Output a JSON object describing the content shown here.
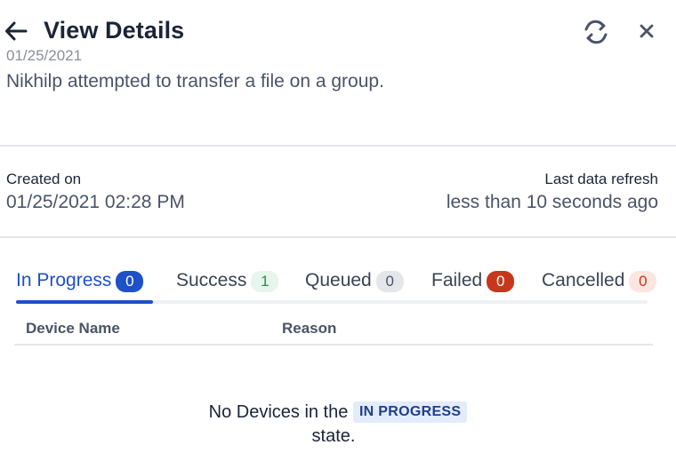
{
  "header": {
    "title": "View Details"
  },
  "event": {
    "date": "01/25/2021",
    "description": "Nikhilp attempted to transfer a file on a group."
  },
  "meta": {
    "created_label": "Created on",
    "created_value": "01/25/2021 02:28 PM",
    "refresh_label": "Last data refresh",
    "refresh_value": "less than 10 seconds ago"
  },
  "tabs": [
    {
      "label": "In Progress",
      "count": "0",
      "active": true,
      "badge_color": "#1e50c8"
    },
    {
      "label": "Success",
      "count": "1",
      "active": false,
      "badge_color": "#e6f6ec"
    },
    {
      "label": "Queued",
      "count": "0",
      "active": false,
      "badge_color": "#e4e6ea"
    },
    {
      "label": "Failed",
      "count": "0",
      "active": false,
      "badge_color": "#c7371b"
    },
    {
      "label": "Cancelled",
      "count": "0",
      "active": false,
      "badge_color": "#fde5e0"
    }
  ],
  "table": {
    "columns": [
      "Device Name",
      "Reason"
    ]
  },
  "empty_state": {
    "prefix": "No Devices in the",
    "status": "IN PROGRESS",
    "suffix": "state."
  },
  "icons": {
    "back": "arrow-left-icon",
    "refresh": "refresh-icon",
    "close": "close-icon"
  },
  "colors": {
    "accent": "#1e50c8",
    "title": "#1b2438",
    "muted": "#8a8f99"
  }
}
